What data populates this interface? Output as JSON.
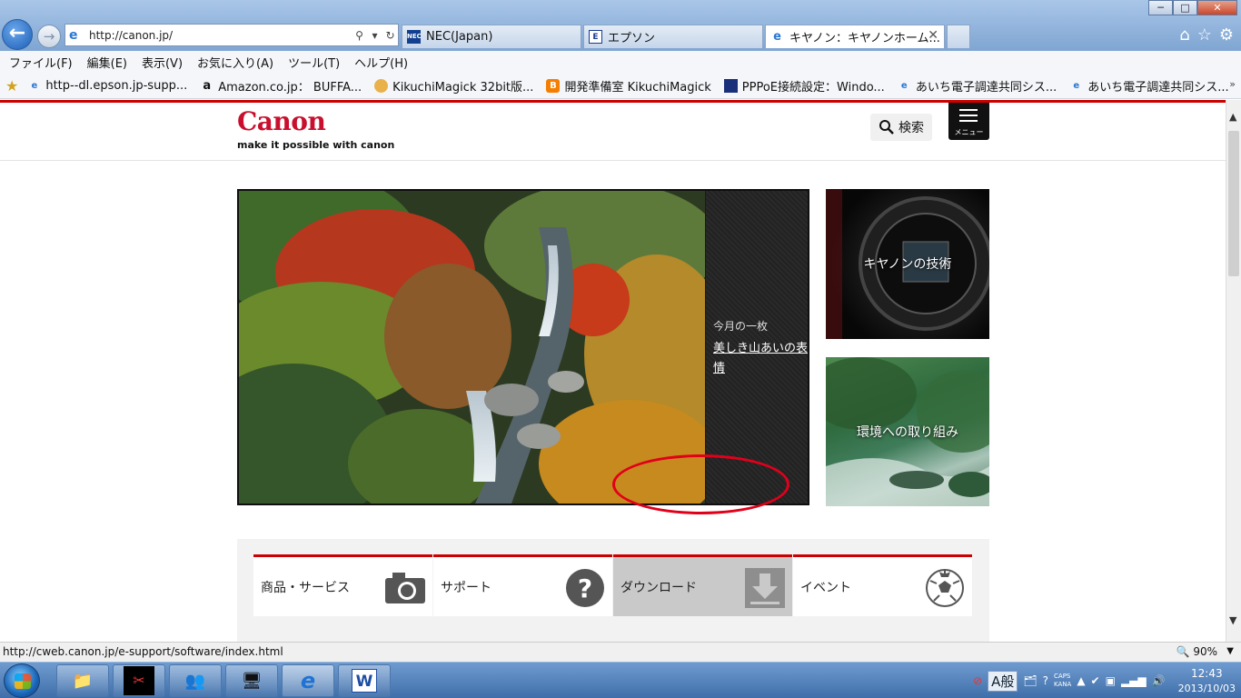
{
  "browser": {
    "url": "http://canon.jp/",
    "tabs": [
      {
        "label": "NEC(Japan)",
        "favicon": "NEC"
      },
      {
        "label": "エプソン",
        "favicon": "E"
      },
      {
        "label": "キヤノン：キヤノンホーム...",
        "favicon": "e"
      }
    ],
    "window_controls": [
      "─",
      "□",
      "✕"
    ]
  },
  "menubar": [
    "ファイル(F)",
    "編集(E)",
    "表示(V)",
    "お気に入り(A)",
    "ツール(T)",
    "ヘルプ(H)"
  ],
  "favorites": [
    {
      "label": "http--dl.epson.jp-supp...",
      "icon": "ie-page-icon"
    },
    {
      "label": "Amazon.co.jp： BUFFA...",
      "icon": "amazon-icon"
    },
    {
      "label": "KikuchiMagick 32bit版...",
      "icon": "cat-icon"
    },
    {
      "label": "開発準備室 KikuchiMagick",
      "icon": "blogger-icon"
    },
    {
      "label": "PPPoE接続設定：Windo...",
      "icon": "flag-icon"
    },
    {
      "label": "あいち電子調達共同シス...",
      "icon": "ie-page-icon"
    },
    {
      "label": "あいち電子調達共同シス...",
      "icon": "ie-page-icon"
    }
  ],
  "site": {
    "logo": "Canon",
    "tagline": "make it possible with canon",
    "search_label": "検索",
    "menu_label": "メニュー",
    "hero": {
      "kicker": "今月の一枚",
      "title": "美しき山あいの表情"
    },
    "cards": [
      {
        "label": "キヤノンの技術"
      },
      {
        "label": "環境への取り組み"
      }
    ],
    "categories": [
      {
        "label": "商品・サービス",
        "icon": "camera-icon"
      },
      {
        "label": "サポート",
        "icon": "question-icon"
      },
      {
        "label": "ダウンロード",
        "icon": "download-icon"
      },
      {
        "label": "イベント",
        "icon": "soccer-ball-icon"
      }
    ]
  },
  "statusbar": {
    "url": "http://cweb.canon.jp/e-support/software/index.html",
    "zoom": "90%"
  },
  "taskbar": {
    "ime": "A般",
    "caps": "CAPS",
    "kana": "KANA",
    "time": "12:43",
    "date": "2013/10/03"
  },
  "colors": {
    "canon_red": "#c8102e",
    "accent_red": "#cc0000",
    "annotation_red": "#e1001a"
  }
}
